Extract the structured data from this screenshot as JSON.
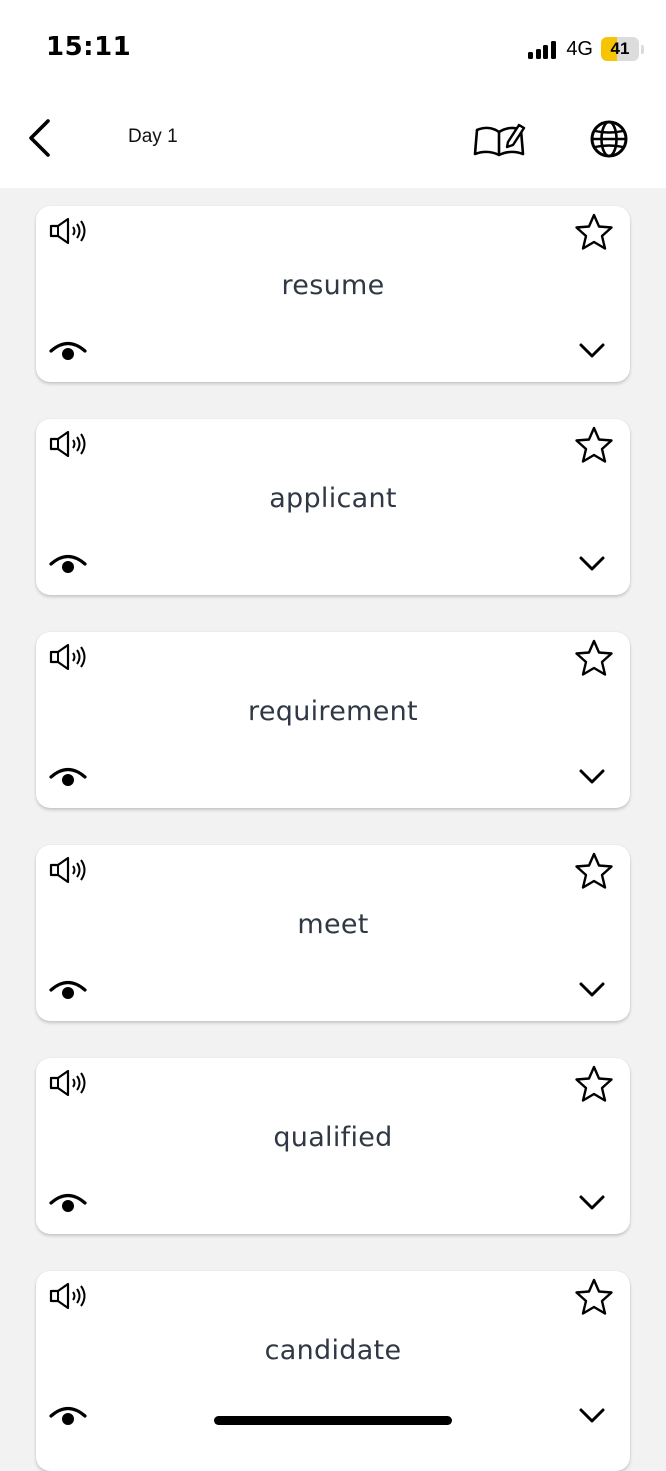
{
  "status_bar": {
    "time": "15:11",
    "network": "4G",
    "battery_level": "41",
    "battery_fraction": 0.41,
    "battery_color": "#f6c400"
  },
  "nav": {
    "title": "Day 1",
    "back_icon": "chevron-left-icon",
    "book_icon": "book-edit-icon",
    "globe_icon": "globe-icon"
  },
  "words": [
    {
      "word": "resume"
    },
    {
      "word": "applicant"
    },
    {
      "word": "requirement"
    },
    {
      "word": "meet"
    },
    {
      "word": "qualified"
    },
    {
      "word": "candidate"
    }
  ],
  "card_icons": {
    "pronounce": "speaker-icon",
    "favorite": "star-icon",
    "reveal": "eye-icon",
    "expand": "chevron-down-icon"
  },
  "colors": {
    "background": "#f2f2f2",
    "card": "#ffffff",
    "word_text": "#2f3844"
  }
}
